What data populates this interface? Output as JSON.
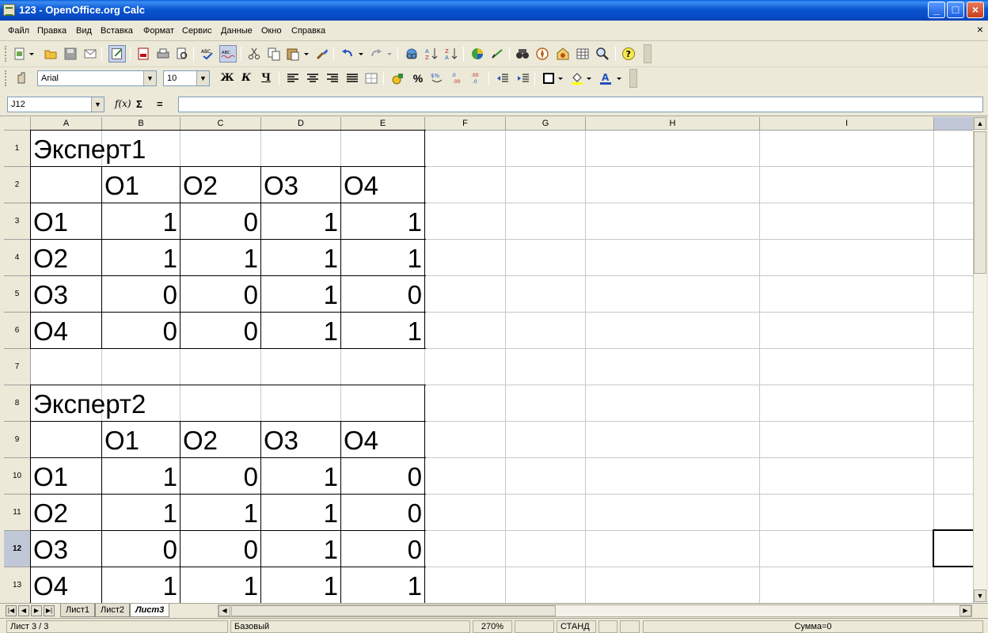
{
  "window": {
    "title": "123 - OpenOffice.org Calc",
    "minimize": "_",
    "maximize": "□",
    "close": "×"
  },
  "menu": [
    "Файл",
    "Правка",
    "Вид",
    "Вставка",
    "Формат",
    "Сервис",
    "Данные",
    "Окно",
    "Справка"
  ],
  "doc_close": "×",
  "format_toolbar": {
    "font_name": "Arial",
    "font_size": "10",
    "bold": "Ж",
    "italic": "К",
    "underline": "Ч"
  },
  "formula_bar": {
    "name_box": "J12",
    "fx_label": "f(x)",
    "sum_label": "Σ",
    "equals_label": "=",
    "formula": ""
  },
  "columns": [
    "A",
    "B",
    "C",
    "D",
    "E",
    "F",
    "G",
    "H",
    "I"
  ],
  "rows": [
    "1",
    "2",
    "3",
    "4",
    "5",
    "6",
    "7",
    "8",
    "9",
    "10",
    "11",
    "12",
    "13"
  ],
  "cells": {
    "A1": "Эксперт1",
    "B2": "O1",
    "C2": "O2",
    "D2": "O3",
    "E2": "O4",
    "A3": "O1",
    "B3": "1",
    "C3": "0",
    "D3": "1",
    "E3": "1",
    "A4": "O2",
    "B4": "1",
    "C4": "1",
    "D4": "1",
    "E4": "1",
    "A5": "O3",
    "B5": "0",
    "C5": "0",
    "D5": "1",
    "E5": "0",
    "A6": "O4",
    "B6": "0",
    "C6": "0",
    "D6": "1",
    "E6": "1",
    "A8": "Эксперт2",
    "B9": "O1",
    "C9": "O2",
    "D9": "O3",
    "E9": "O4",
    "A10": "O1",
    "B10": "1",
    "C10": "0",
    "D10": "1",
    "E10": "0",
    "A11": "O2",
    "B11": "1",
    "C11": "1",
    "D11": "1",
    "E11": "0",
    "A12": "O3",
    "B12": "0",
    "C12": "0",
    "D12": "1",
    "E12": "0",
    "A13": "O4",
    "B13": "1",
    "C13": "1",
    "D13": "1",
    "E13": "1"
  },
  "sheet_tabs": [
    "Лист1",
    "Лист2",
    "Лист3"
  ],
  "active_tab": "Лист3",
  "status": {
    "sheet": "Лист 3 / 3",
    "style": "Базовый",
    "zoom": "270%",
    "mode": "СТАНД",
    "sum": "Сумма=0"
  }
}
